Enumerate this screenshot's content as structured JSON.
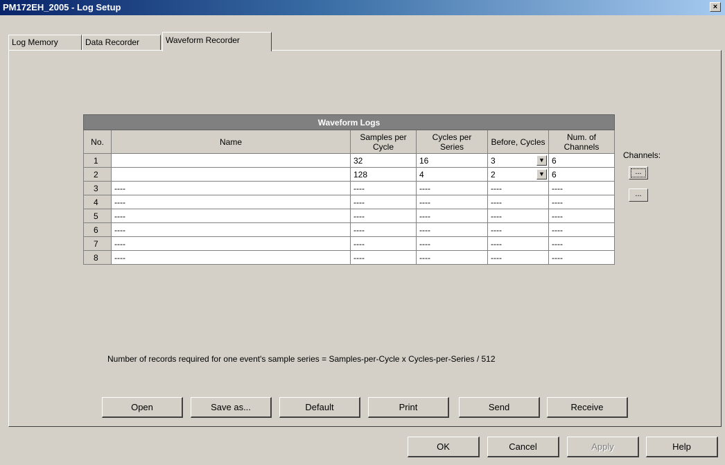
{
  "window": {
    "title": "PM172EH_2005 - Log Setup",
    "close_label": "×"
  },
  "tabs": [
    {
      "label": "Log Memory",
      "active": false
    },
    {
      "label": "Data Recorder",
      "active": false
    },
    {
      "label": "Waveform Recorder",
      "active": true
    }
  ],
  "table": {
    "caption": "Waveform Logs",
    "columns": [
      "No.",
      "Name",
      "Samples per Cycle",
      "Cycles per Series",
      "Before, Cycles",
      "Num. of Channels"
    ],
    "rows": [
      {
        "no": "1",
        "name": "",
        "samples": "32",
        "cycles": "16",
        "before": "3",
        "channels": "6"
      },
      {
        "no": "2",
        "name": "",
        "samples": "128",
        "cycles": "4",
        "before": "2",
        "channels": "6"
      },
      {
        "no": "3",
        "name": "----",
        "samples": "----",
        "cycles": "----",
        "before": "----",
        "channels": "----"
      },
      {
        "no": "4",
        "name": "----",
        "samples": "----",
        "cycles": "----",
        "before": "----",
        "channels": "----"
      },
      {
        "no": "5",
        "name": "----",
        "samples": "----",
        "cycles": "----",
        "before": "----",
        "channels": "----"
      },
      {
        "no": "6",
        "name": "----",
        "samples": "----",
        "cycles": "----",
        "before": "----",
        "channels": "----"
      },
      {
        "no": "7",
        "name": "----",
        "samples": "----",
        "cycles": "----",
        "before": "----",
        "channels": "----"
      },
      {
        "no": "8",
        "name": "----",
        "samples": "----",
        "cycles": "----",
        "before": "----",
        "channels": "----"
      }
    ]
  },
  "channels": {
    "label": "Channels:",
    "button_label": "..."
  },
  "note": "Number of records required for one event's sample series = Samples-per-Cycle x Cycles-per-Series / 512",
  "actions": {
    "open": "Open",
    "save_as": "Save as...",
    "default": "Default",
    "print": "Print",
    "send": "Send",
    "receive": "Receive"
  },
  "dialog": {
    "ok": "OK",
    "cancel": "Cancel",
    "apply": "Apply",
    "help": "Help"
  }
}
